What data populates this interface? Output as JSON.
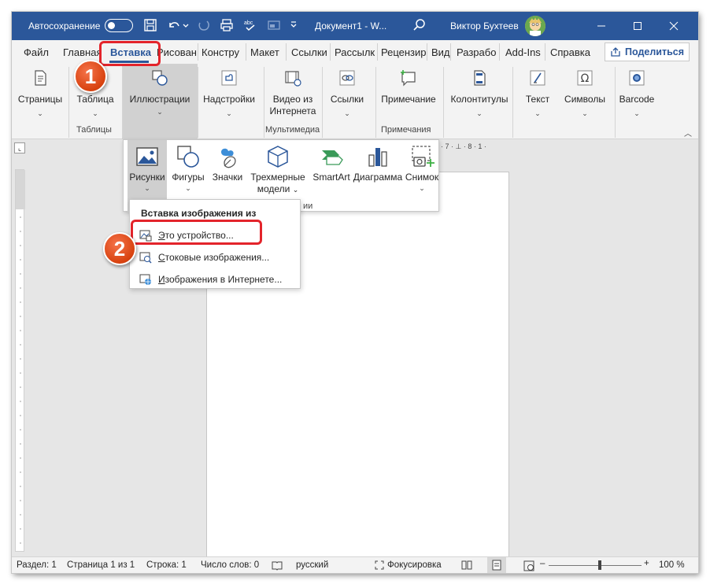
{
  "titlebar": {
    "autosave_label": "Автосохранение",
    "doc_title": "Документ1 - W...",
    "user_name": "Виктор Бухтеев"
  },
  "tabs": [
    {
      "label": "Файл"
    },
    {
      "label": "Главная"
    },
    {
      "label": "Вставка"
    },
    {
      "label": "Рисован"
    },
    {
      "label": "Констру"
    },
    {
      "label": "Макет"
    },
    {
      "label": "Ссылки"
    },
    {
      "label": "Рассылк"
    },
    {
      "label": "Рецензир"
    },
    {
      "label": "Вид"
    },
    {
      "label": "Разрабо"
    },
    {
      "label": "Add-Ins"
    },
    {
      "label": "Справка"
    }
  ],
  "share_label": "Поделиться",
  "ribbon": {
    "pages": "Страницы",
    "table": "Таблица",
    "table_group": "Таблицы",
    "illustrations": "Иллюстрации",
    "addins": "Надстройки",
    "video_line1": "Видео из",
    "video_line2": "Интернета",
    "media_group": "Мультимедиа",
    "links": "Ссылки",
    "comment": "Примечание",
    "comments_group": "Примечания",
    "headers": "Колонтитулы",
    "text": "Текст",
    "symbols": "Символы",
    "barcode": "Barcode"
  },
  "gallery": {
    "pictures": "Рисунки",
    "shapes": "Фигуры",
    "icons": "Значки",
    "models_line1": "Трехмерные",
    "models_line2": "модели",
    "smartart": "SmartArt",
    "chart": "Диаграмма",
    "screenshot": "Снимок",
    "group_fragment": "ии"
  },
  "submenu": {
    "header": "Вставка изображения из",
    "items": [
      {
        "label": "Это устройство...",
        "accel": "Э"
      },
      {
        "label": "Стоковые изображения...",
        "accel": "С"
      },
      {
        "label": "Изображения в Интернете...",
        "accel": "И"
      }
    ]
  },
  "statusbar": {
    "section": "Раздел: 1",
    "page": "Страница 1 из 1",
    "line": "Строка: 1",
    "words": "Число слов: 0",
    "language": "русский",
    "focus": "Фокусировка",
    "zoom": "100 %"
  },
  "ruler_hint": "· 7 · ⊥ · 8 · 1 ·",
  "callouts": [
    "1",
    "2"
  ],
  "colors": {
    "accent": "#2b579a",
    "callout": "#e0491a",
    "highlight": "#e3242b"
  }
}
